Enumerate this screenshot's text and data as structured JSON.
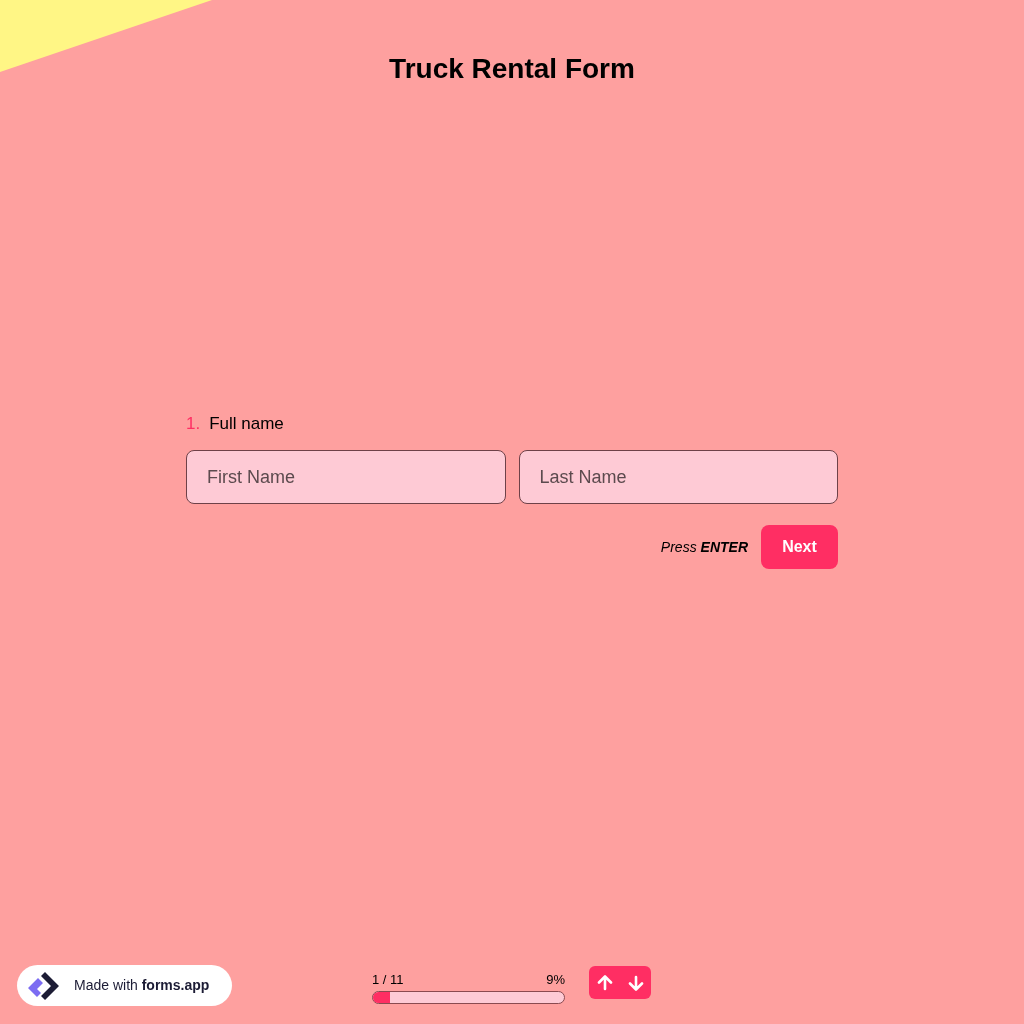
{
  "form": {
    "title": "Truck Rental Form"
  },
  "question": {
    "number": "1.",
    "label": "Full name",
    "fields": [
      {
        "placeholder": "First Name"
      },
      {
        "placeholder": "Last Name"
      }
    ]
  },
  "submit": {
    "hint": "Press **ENTER**",
    "button": "Next"
  },
  "footer": {
    "badge": "Made with **forms.app**",
    "progress": {
      "step": "1 / 11",
      "percent": "9%",
      "level": 0.09
    },
    "nav": [
      {
        "kind": "up"
      },
      {
        "kind": "down"
      }
    ]
  }
}
